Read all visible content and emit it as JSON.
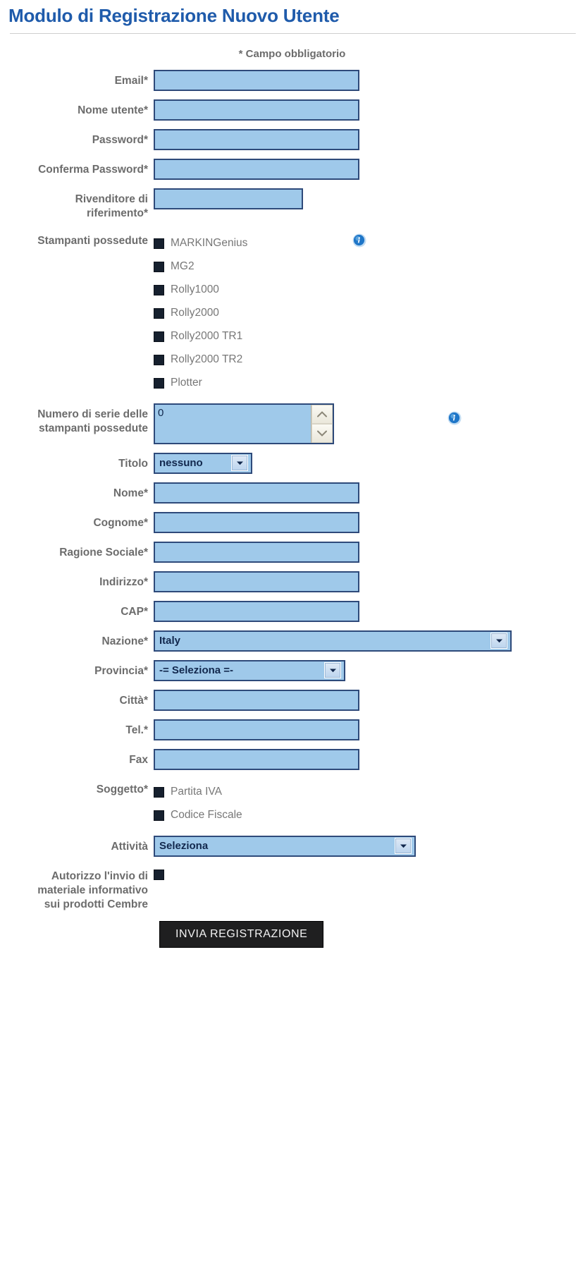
{
  "header": {
    "title": "Modulo di Registrazione Nuovo Utente",
    "required_note": "* Campo obbligatorio"
  },
  "colors": {
    "title_blue": "#1f5bab",
    "input_fill": "#9fc9ea",
    "input_border": "#2e4a7a",
    "label_gray": "#6c6c6c",
    "checkbox_dark": "#16202e",
    "submit_bg": "#1f1f20",
    "info_icon_blue": "#1f76c8"
  },
  "fields": {
    "email": {
      "label": "Email",
      "required": "*",
      "value": "",
      "placeholder": ""
    },
    "username": {
      "label": "Nome utente",
      "required": "*",
      "value": "",
      "placeholder": ""
    },
    "password": {
      "label": "Password",
      "required": "*",
      "value": "",
      "placeholder": ""
    },
    "confirm_password": {
      "label": "Conferma Password",
      "required": "*",
      "value": "",
      "placeholder": ""
    },
    "reseller": {
      "label_line1": "Rivenditore di",
      "label_line2": "riferimento",
      "required": "*",
      "value": "",
      "placeholder": ""
    },
    "printers_owned": {
      "label": "Stampanti possedute",
      "info_icon": "info-icon"
    },
    "serial_numbers": {
      "label_line1": "Numero di serie delle",
      "label_line2": "stampanti possedute",
      "value": "0",
      "info_icon": "info-icon"
    },
    "titolo": {
      "label": "Titolo",
      "value": "nessuno"
    },
    "nome": {
      "label": "Nome",
      "required": "*",
      "value": "",
      "placeholder": ""
    },
    "cognome": {
      "label": "Cognome",
      "required": "*",
      "value": "",
      "placeholder": ""
    },
    "ragione_sociale": {
      "label": "Ragione Sociale",
      "required": "*",
      "value": "",
      "placeholder": ""
    },
    "indirizzo": {
      "label": "Indirizzo",
      "required": "*",
      "value": "",
      "placeholder": ""
    },
    "cap": {
      "label": "CAP",
      "required": "*",
      "value": "",
      "placeholder": ""
    },
    "nazione": {
      "label": "Nazione",
      "required": "*",
      "value": "Italy"
    },
    "provincia": {
      "label": "Provincia",
      "required": "*",
      "value": "-= Seleziona =-"
    },
    "citta": {
      "label": "Città",
      "required": "*",
      "value": "",
      "placeholder": ""
    },
    "tel": {
      "label": "Tel.",
      "required": "*",
      "value": "",
      "placeholder": ""
    },
    "fax": {
      "label": "Fax",
      "required": "",
      "value": "",
      "placeholder": ""
    },
    "soggetto": {
      "label": "Soggetto",
      "required": "*"
    },
    "attivita": {
      "label": "Attività",
      "value": "Seleziona"
    },
    "newsletter": {
      "label_line1": "Autorizzo l'invio di",
      "label_line2": "materiale informativo",
      "label_line3": "sui prodotti Cembre",
      "checked": false
    }
  },
  "printers": [
    {
      "label": "MARKINGenius",
      "checked": false
    },
    {
      "label": "MG2",
      "checked": false
    },
    {
      "label": "Rolly1000",
      "checked": false
    },
    {
      "label": "Rolly2000",
      "checked": false
    },
    {
      "label": "Rolly2000 TR1",
      "checked": false
    },
    {
      "label": "Rolly2000 TR2",
      "checked": false
    },
    {
      "label": "Plotter",
      "checked": false
    }
  ],
  "soggetto_options": [
    {
      "label": "Partita IVA",
      "checked": false
    },
    {
      "label": "Codice Fiscale",
      "checked": false
    }
  ],
  "submit": {
    "label": "INVIA REGISTRAZIONE"
  }
}
